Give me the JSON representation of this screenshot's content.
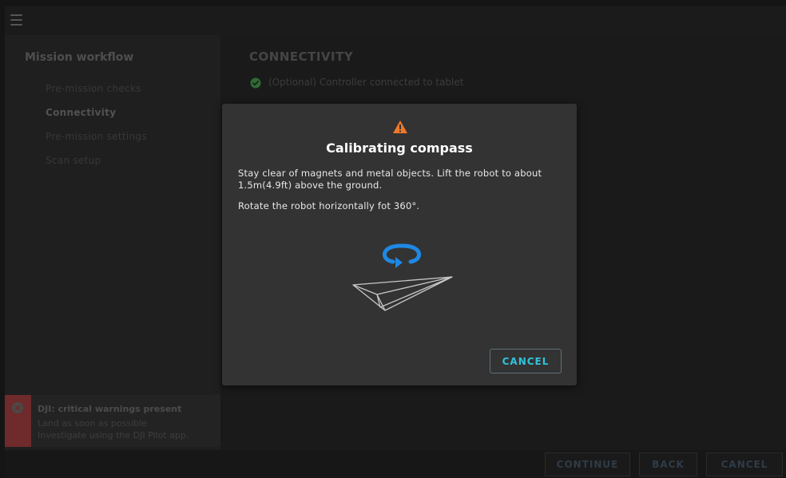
{
  "sidebar": {
    "title": "Mission workflow",
    "items": [
      {
        "label": "Pre-mission checks"
      },
      {
        "label": "Connectivity"
      },
      {
        "label": "Pre-mission settings"
      },
      {
        "label": "Scan setup"
      }
    ]
  },
  "warning": {
    "title": "DJI: critical warnings present",
    "line1": "Land as soon as possible",
    "line2": "Investigate using the DJI Pilot app."
  },
  "main": {
    "title": "CONNECTIVITY",
    "check_label": "(Optional) Controller connected to tablet"
  },
  "dialog": {
    "title": "Calibrating compass",
    "paragraph1": "Stay clear of magnets and metal objects. Lift the robot to about 1.5m(4.9ft) above the ground.",
    "paragraph2": "Rotate the robot horizontally fot 360°.",
    "cancel_label": "CANCEL"
  },
  "bottombar": {
    "continue_label": "CONTINUE",
    "back_label": "BACK",
    "cancel_label": "CANCEL"
  },
  "icons": {
    "menu": "menu-icon",
    "warning": "warning-triangle-icon",
    "rotate": "rotate-icon",
    "plane": "paper-plane-icon",
    "check": "check-circle-icon",
    "error": "error-circle-icon"
  },
  "colors": {
    "accent": "#31c3dc",
    "warning_orange": "#f0782a",
    "rotate_blue": "#1e88e5",
    "check_green": "#3a7d3f",
    "error_red": "#6f2a2b"
  }
}
